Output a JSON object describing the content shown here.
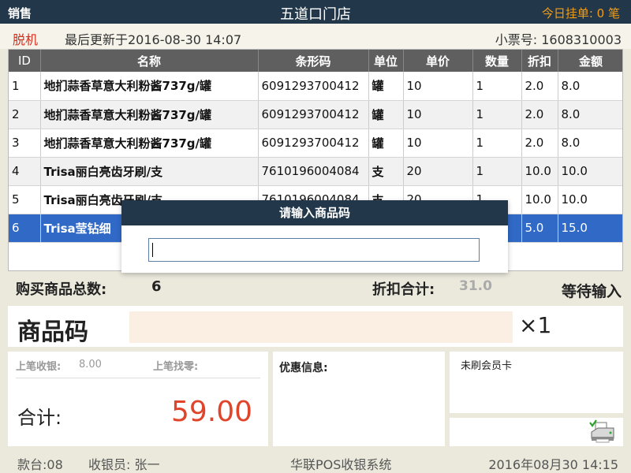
{
  "titlebar": {
    "mode": "销售",
    "store": "五道口门店",
    "held_label": "今日挂单:",
    "held_count": "0",
    "held_unit": "笔"
  },
  "info": {
    "status": "脱机",
    "last_update": "最后更新于2016-08-30 14:07",
    "receipt_label": "小票号:",
    "receipt_no": "1608310003"
  },
  "table": {
    "headers": [
      "ID",
      "名称",
      "条形码",
      "单位",
      "单价",
      "数量",
      "折扣",
      "金额"
    ],
    "rows": [
      {
        "id": "1",
        "name": "地扪蒜香草意大利粉酱737g/罐",
        "barcode": "6091293700412",
        "unit": "罐",
        "price": "10",
        "qty": "1",
        "discount": "2.0",
        "amount": "8.0"
      },
      {
        "id": "2",
        "name": "地扪蒜香草意大利粉酱737g/罐",
        "barcode": "6091293700412",
        "unit": "罐",
        "price": "10",
        "qty": "1",
        "discount": "2.0",
        "amount": "8.0"
      },
      {
        "id": "3",
        "name": "地扪蒜香草意大利粉酱737g/罐",
        "barcode": "6091293700412",
        "unit": "罐",
        "price": "10",
        "qty": "1",
        "discount": "2.0",
        "amount": "8.0"
      },
      {
        "id": "4",
        "name": "Trisa丽白亮齿牙刷/支",
        "barcode": "7610196004084",
        "unit": "支",
        "price": "20",
        "qty": "1",
        "discount": "10.0",
        "amount": "10.0"
      },
      {
        "id": "5",
        "name": "Trisa丽白亮齿牙刷/支",
        "barcode": "7610196004084",
        "unit": "支",
        "price": "20",
        "qty": "1",
        "discount": "10.0",
        "amount": "10.0"
      },
      {
        "id": "6",
        "name": "Trisa莹钻细",
        "barcode": "",
        "unit": "",
        "price": "",
        "qty": "",
        "discount": "5.0",
        "amount": "15.0"
      }
    ]
  },
  "summary": {
    "count_label": "购买商品总数:",
    "count_value": "6",
    "discount_label": "折扣合计:",
    "discount_value": "31.0",
    "status": "等待输入"
  },
  "code": {
    "label": "商品码",
    "multiplier": "×1"
  },
  "payment": {
    "last_pay_label": "上笔收银:",
    "last_pay_value": "8.00",
    "last_change_label": "上笔找零:",
    "total_label": "合计:",
    "total_value": "59.00"
  },
  "promo": {
    "label": "优惠信息:"
  },
  "member": {
    "label": "未刷会员卡"
  },
  "footer": {
    "terminal": "款台:08",
    "cashier": "收银员: 张一",
    "system": "华联POS收银系统",
    "datetime": "2016年08月30  14:15"
  },
  "modal": {
    "title": "请输入商品码"
  },
  "colors": {
    "header_bg": "#22384a",
    "accent_orange": "#f39c12",
    "total_red": "#e0442b",
    "selected_row": "#3069c6",
    "table_header": "#5f5f5f"
  }
}
